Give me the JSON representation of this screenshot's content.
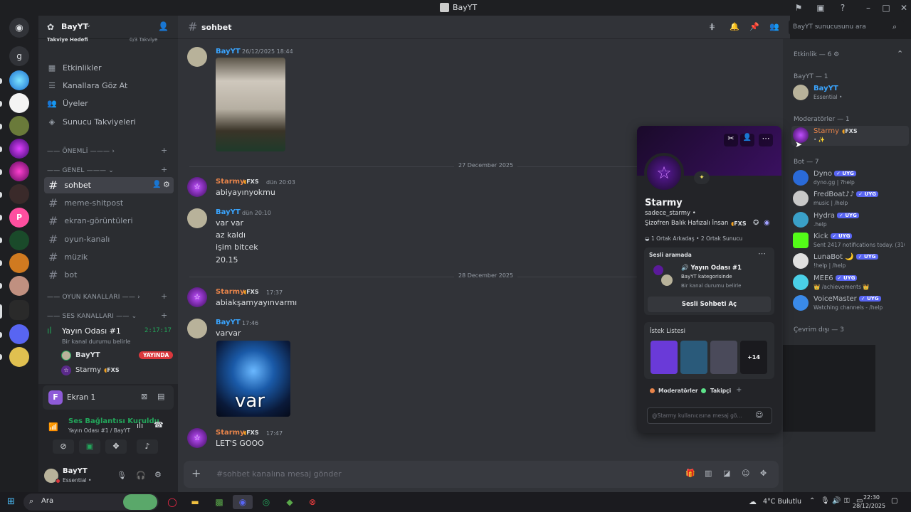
{
  "window": {
    "title": "BayYT"
  },
  "server": {
    "name": "BayYT",
    "boost_text": "Takviye Hedefi",
    "boost_progress": "0/3 Takviye"
  },
  "nav": [
    {
      "label": "Etkinlikler",
      "icon": "calendar-icon"
    },
    {
      "label": "Kanallara Göz At",
      "icon": "browse-icon"
    },
    {
      "label": "Üyeler",
      "icon": "members-icon"
    },
    {
      "label": "Sunucu Takviyeleri",
      "icon": "boost-icon"
    }
  ],
  "categories": {
    "important": "—— ÖNEMLİ ———",
    "general": "—— GENEL ———",
    "games": "—— OYUN KANALLARI ——",
    "voice": "—— SES KANALLARI ——"
  },
  "channels": [
    "sohbet",
    "meme-shitpost",
    "ekran-görüntüleri",
    "oyun-kanalı",
    "müzik",
    "bot"
  ],
  "voice_channel": {
    "name": "Yayın Odası #1",
    "timer": "2:17:17",
    "status": "Bir kanal durumu belirle",
    "users": [
      {
        "name": "BayYT",
        "badge": "YAYINDA"
      },
      {
        "name": "Starmy",
        "tag": "FXS"
      }
    ]
  },
  "screen_share": {
    "label": "Ekran 1",
    "initial": "F"
  },
  "voice_status": {
    "title": "Ses Bağlantısı Kuruldu",
    "sub": "Yayın Odası #1 / BayYT"
  },
  "user": {
    "name": "BayYT",
    "status": "Essential •"
  },
  "current_channel": "sohbet",
  "messages": [
    {
      "author": "BayYT",
      "time": "26/12/2025 18:44",
      "lines": [],
      "image": "mask"
    },
    {
      "divider": "27 December 2025"
    },
    {
      "author": "Starmy",
      "tag": "FXS",
      "time": "dün 20:03",
      "lines": [
        "abiyayınyokmu"
      ]
    },
    {
      "author": "BayYT",
      "time": "dün 20:10",
      "lines": [
        "var var",
        "az kaldı",
        "işim bitcek",
        "20.15"
      ]
    },
    {
      "divider": "28 December 2025"
    },
    {
      "author": "Starmy",
      "tag": "FXS",
      "time": "17:37",
      "lines": [
        "abiakşamyayınvarmı"
      ]
    },
    {
      "author": "BayYT",
      "time": "17:46",
      "lines": [
        "varvar"
      ],
      "image_text": "var"
    },
    {
      "author": "Starmy",
      "tag": "FXS",
      "time": "17:47",
      "lines": [
        "LET'S GOOO"
      ]
    }
  ],
  "composer": {
    "placeholder": "#sohbet kanalına mesaj gönder"
  },
  "search": {
    "placeholder": "BayYT sunucusunu ara"
  },
  "members": {
    "activity_header": "Etkinlik — 6",
    "groups": [
      {
        "title": "BayYT — 1",
        "items": [
          {
            "name": "BayYT",
            "status": "Essential •",
            "color": "#3aa5ff"
          }
        ]
      },
      {
        "title": "Moderatörler — 1",
        "items": [
          {
            "name": "Starmy",
            "tag": "FXS",
            "status": "• ✨",
            "color": "#e8844a"
          }
        ]
      },
      {
        "title": "Bot — 7",
        "items": [
          {
            "name": "Dyno",
            "status": "dyno.gg | ?help"
          },
          {
            "name": "FredBoat♪♪",
            "status": "music | /help"
          },
          {
            "name": "Hydra",
            "status": ".help"
          },
          {
            "name": "Kick",
            "status": "Sent 2417 notifications today. (3101..."
          },
          {
            "name": "LunaBot 🌙",
            "status": "!help | /help"
          },
          {
            "name": "MEE6",
            "status": "👑 /achievements 👑"
          },
          {
            "name": "VoiceMaster",
            "status": "Watching channels - /help"
          }
        ]
      },
      {
        "title": "Çevrim dışı — 3",
        "items": []
      }
    ],
    "bot_badge": "UYG"
  },
  "popup": {
    "display_name": "Starmy",
    "username": "sadece_starmy •",
    "bio": "Şizofren Balık Hafızalı İnsan",
    "tag": "FXS",
    "mutual": "1 Ortak Arkadaş • 2 Ortak Sunucu",
    "voice_title": "Sesli aramada",
    "voice_channel": "🔊 Yayın Odası #1",
    "voice_category": "BayYT kategorisinde",
    "voice_status": "Bir kanal durumu belirle",
    "voice_button": "Sesli Sohbeti Aç",
    "wishlist_title": "İstek Listesi",
    "wishlist_more": "+14",
    "roles": [
      "Moderatörler",
      "Takipçi"
    ],
    "message_placeholder": "@Starmy kullanıcısına mesaj gö..."
  },
  "taskbar": {
    "search": "Ara",
    "weather": "4°C  Bulutlu",
    "time": "22:30",
    "date": "28/12/2025"
  },
  "colors": {
    "accent": "#5865f2",
    "bayyt": "#3aa5ff",
    "starmy": "#e8844a",
    "online": "#23a55a"
  }
}
